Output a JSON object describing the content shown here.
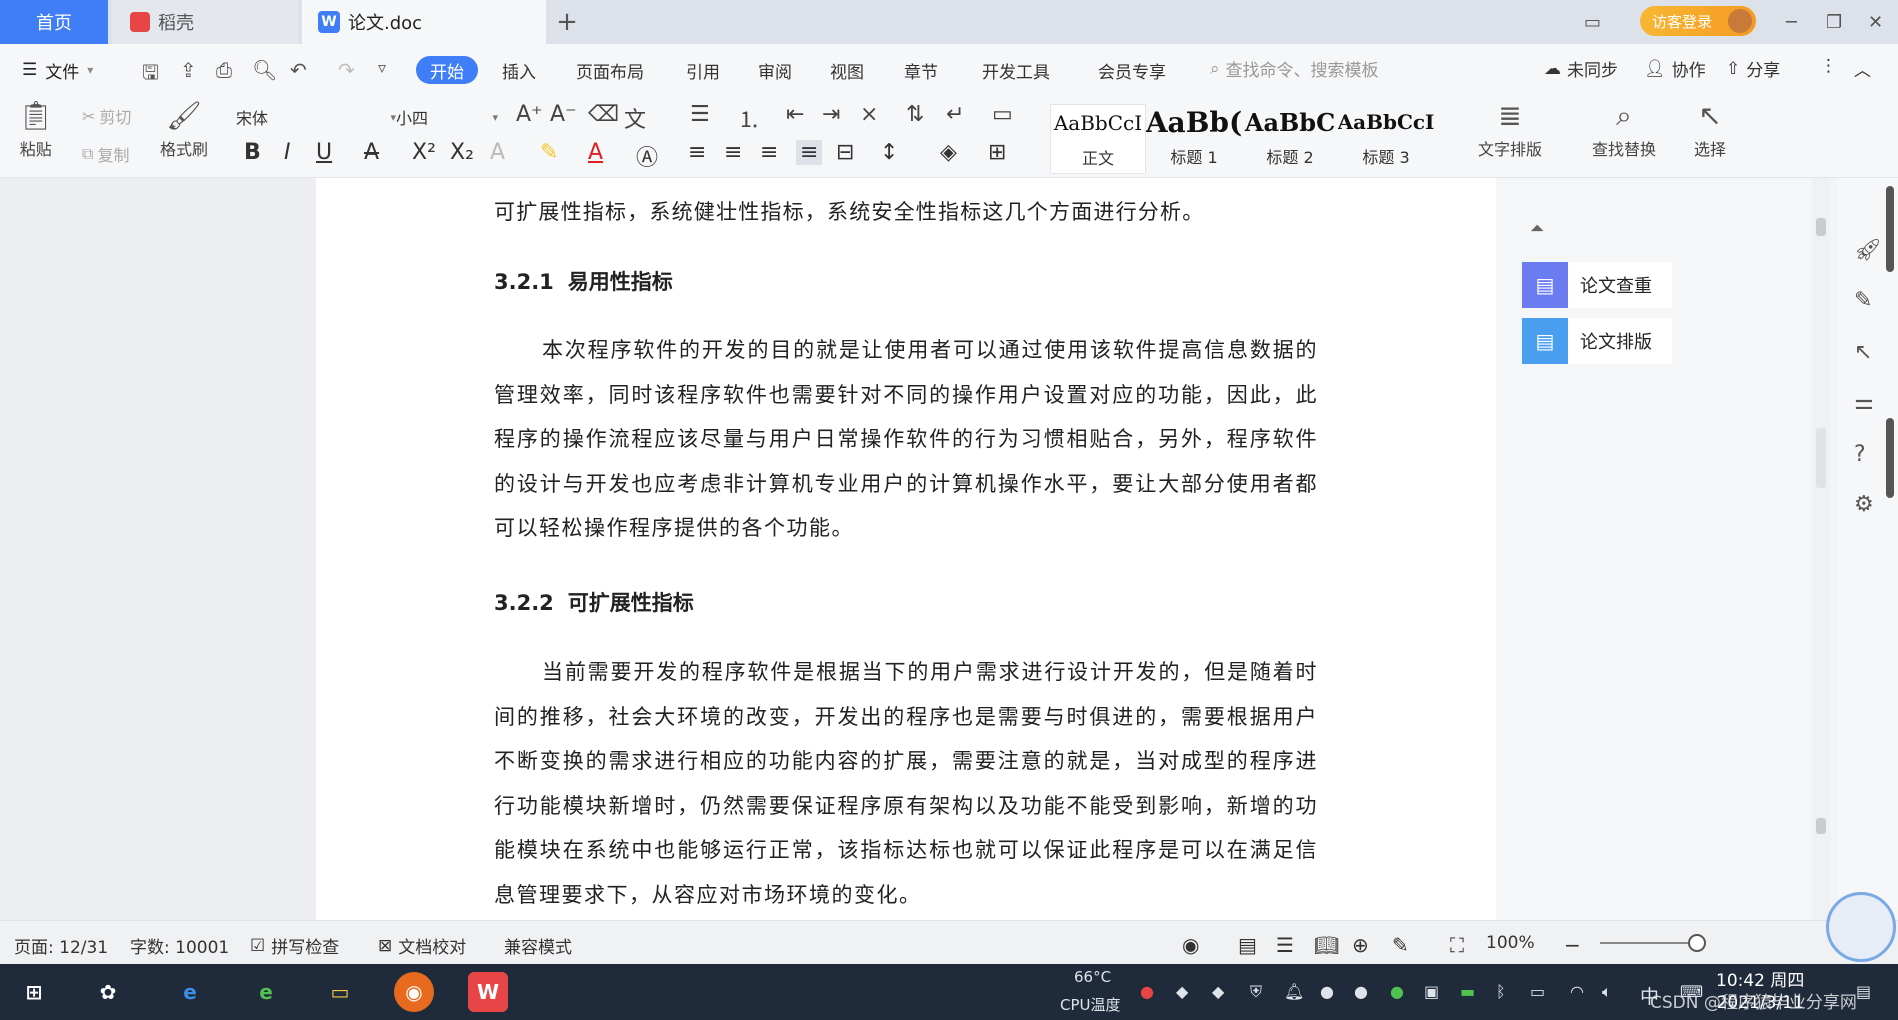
{
  "tabs": {
    "home": "首页",
    "daoke": "稻壳",
    "doc": "论文.doc",
    "login": "访客登录"
  },
  "menu": {
    "file": "文件",
    "items": [
      "开始",
      "插入",
      "页面布局",
      "引用",
      "审阅",
      "视图",
      "章节",
      "开发工具",
      "会员专享"
    ],
    "search_placeholder": "查找命令、搜索模板",
    "sync": "未同步",
    "collab": "协作",
    "share": "分享"
  },
  "ribbon": {
    "paste": "粘贴",
    "cut": "剪切",
    "copy": "复制",
    "format_painter": "格式刷",
    "font": "宋体",
    "size": "小四",
    "styles": [
      {
        "preview": "AaBbCcI",
        "name": "正文"
      },
      {
        "preview": "AaBb(",
        "name": "标题 1"
      },
      {
        "preview": "AaBbC",
        "name": "标题 2"
      },
      {
        "preview": "AaBbCcI",
        "name": "标题 3"
      }
    ],
    "text_layout": "文字排版",
    "find_replace": "查找替换",
    "select": "选择"
  },
  "document": {
    "top_line": "可扩展性指标，系统健壮性指标，系统安全性指标这几个方面进行分析。",
    "h1_num": "3.2.1",
    "h1_title": "易用性指标",
    "p1": "本次程序软件的开发的目的就是让使用者可以通过使用该软件提高信息数据的管理效率，同时该程序软件也需要针对不同的操作用户设置对应的功能，因此，此程序的操作流程应该尽量与用户日常操作软件的行为习惯相贴合，另外，程序软件的设计与开发也应考虑非计算机专业用户的计算机操作水平，要让大部分使用者都可以轻松操作程序提供的各个功能。",
    "h2_num": "3.2.2",
    "h2_title": "可扩展性指标",
    "p2": "当前需要开发的程序软件是根据当下的用户需求进行设计开发的，但是随着时间的推移，社会大环境的改变，开发出的程序也是需要与时俱进的，需要根据用户不断变换的需求进行相应的功能内容的扩展，需要注意的就是，当对成型的程序进行功能模块新增时，仍然需要保证程序原有架构以及功能不能受到影响，新增的功能模块在系统中也能够运行正常，该指标达标也就可以保证此程序是可以在满足信息管理要求下，从容应对市场环境的变化。"
  },
  "side_panel": {
    "plugin1": "论文查重",
    "plugin2": "论文排版"
  },
  "status": {
    "page": "页面: 12/31",
    "words": "字数: 10001",
    "spell": "拼写检查",
    "proof": "文档校对",
    "compat": "兼容模式",
    "zoom": "100%"
  },
  "taskbar": {
    "cpu_temp": "66°C",
    "cpu_label": "CPU温度",
    "ime": "中",
    "time": "10:42 周四",
    "date": "2021/3/11",
    "watermark": "CSDN @程序猿毕业分享网"
  },
  "colors": {
    "accent": "#3f7ef7",
    "taskbar": "#1f2a3a",
    "plugin1": "#6b7cf0",
    "plugin2": "#4a9ef0"
  }
}
